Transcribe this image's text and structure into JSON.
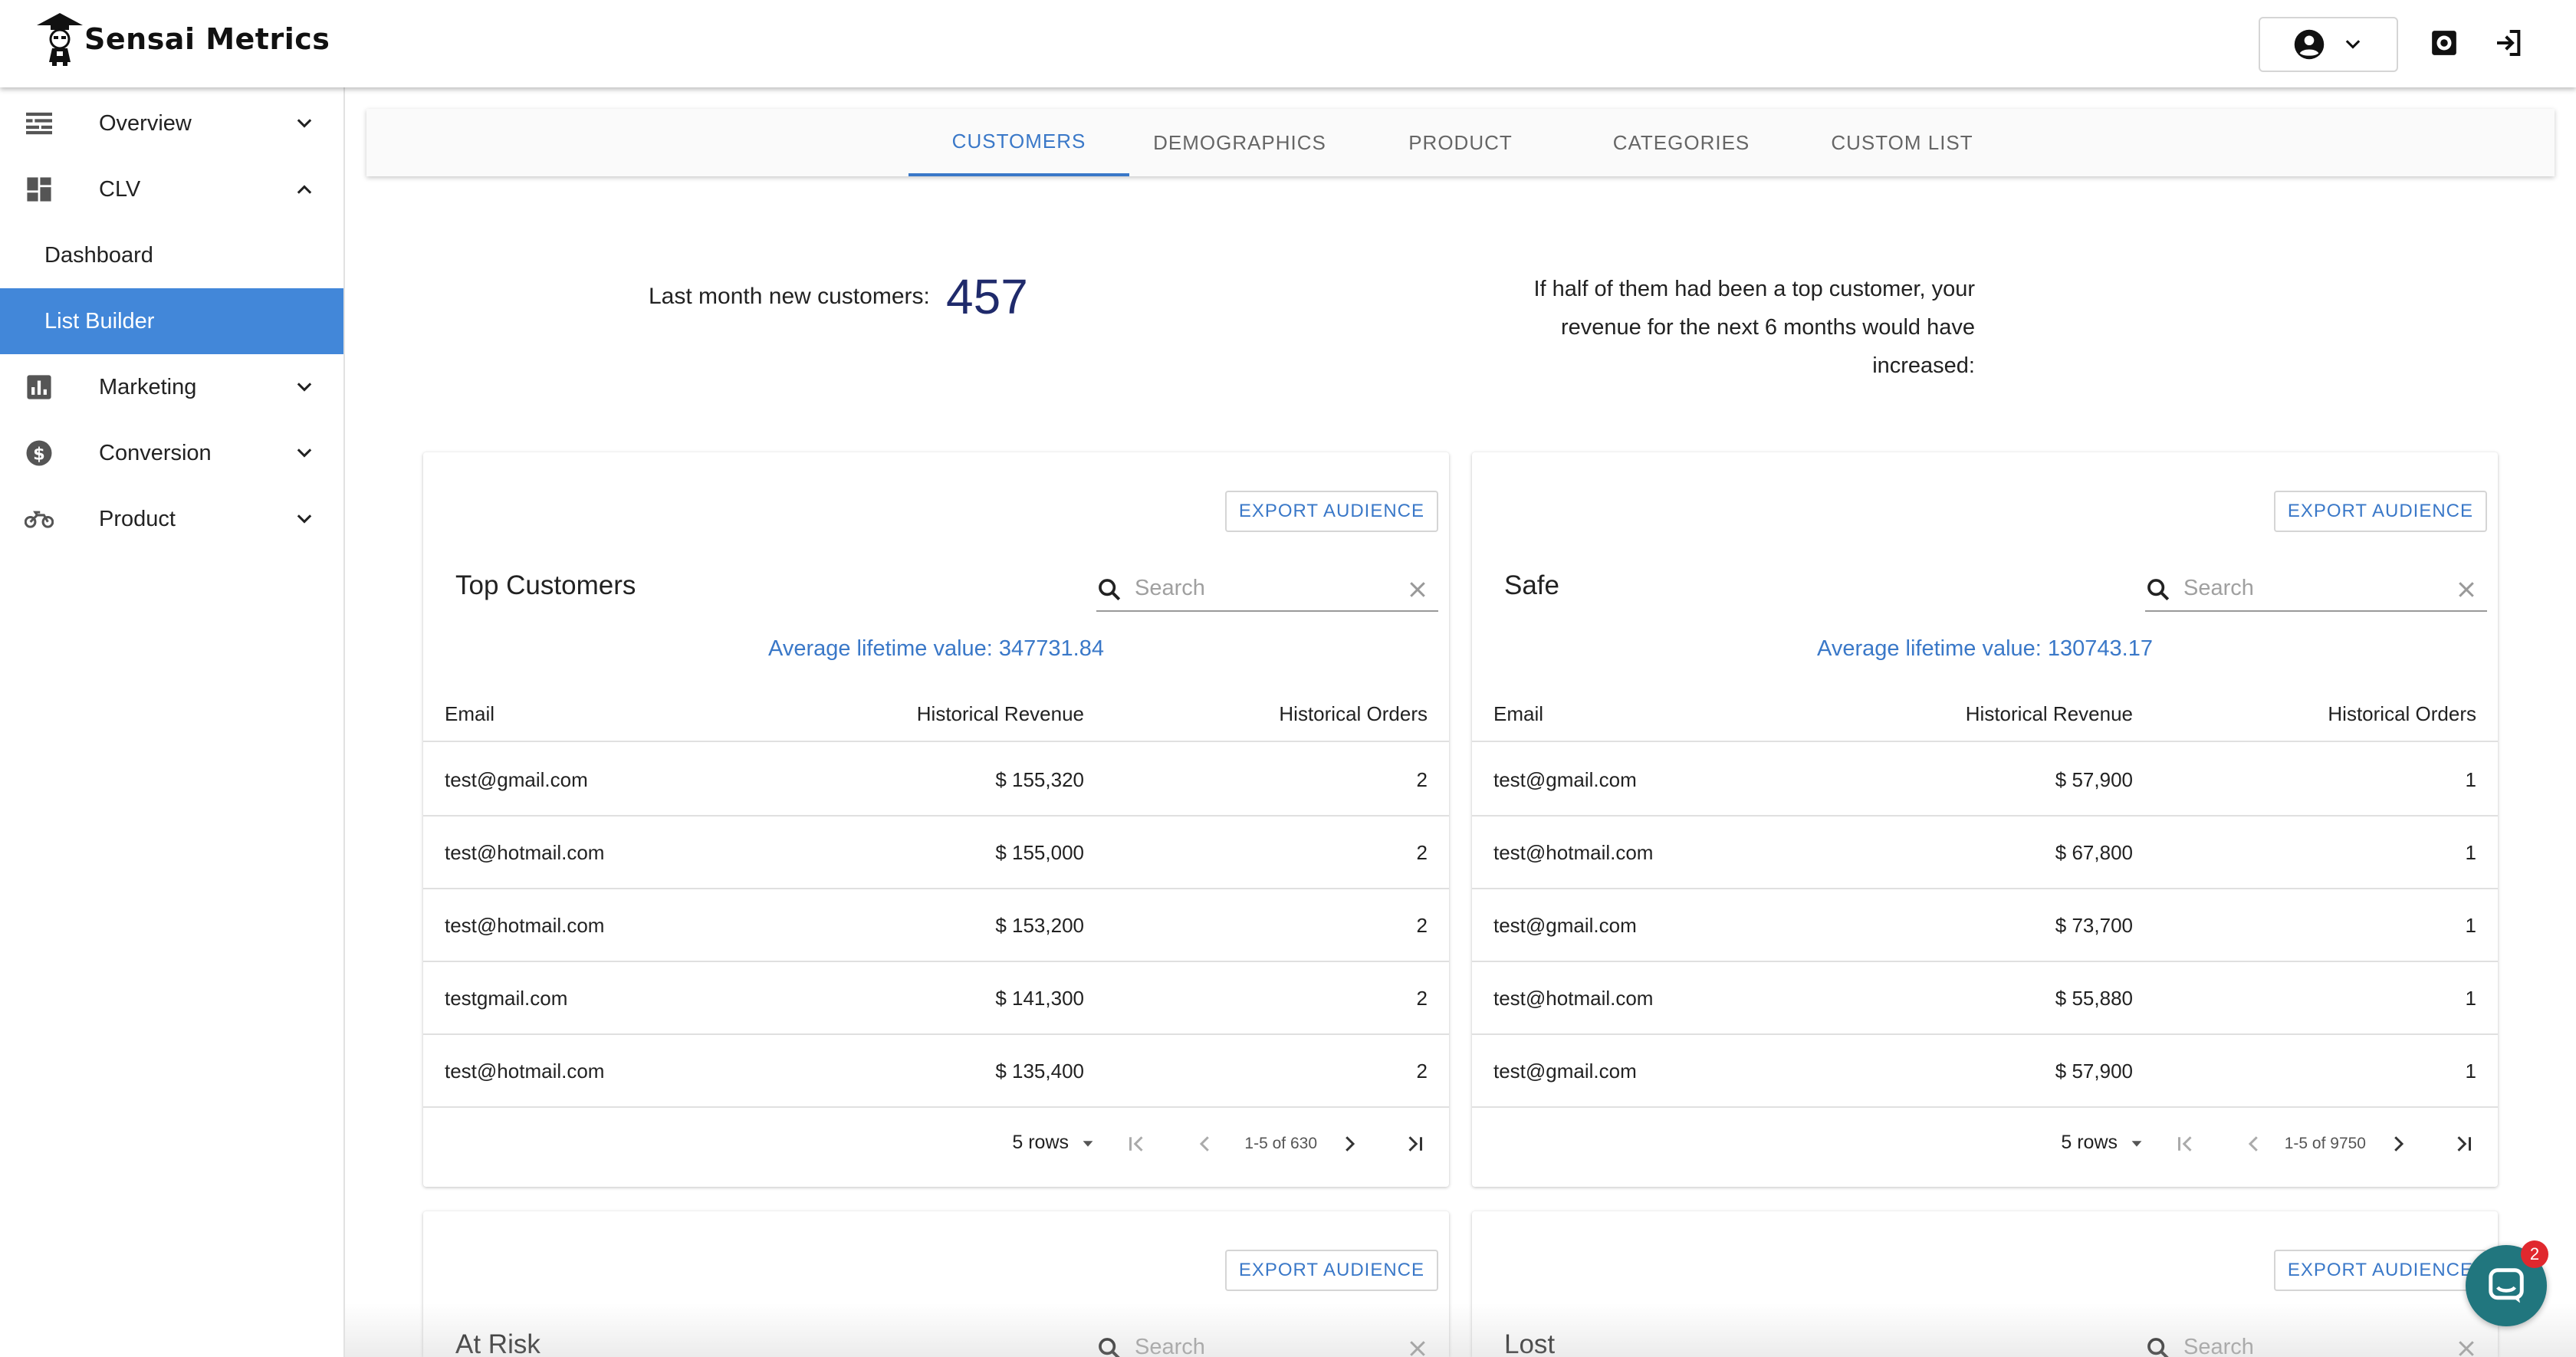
{
  "app": {
    "name": "Sensai Metrics"
  },
  "header": {
    "user_icon": "account-circle-icon",
    "settings_icon": "settings-icon",
    "logout_icon": "logout-icon"
  },
  "sidebar": {
    "items": [
      {
        "label": "Overview",
        "icon": "overview-icon",
        "expanded": false
      },
      {
        "label": "CLV",
        "icon": "dashboard-icon",
        "expanded": true,
        "children": [
          {
            "label": "Dashboard",
            "active": false
          },
          {
            "label": "List Builder",
            "active": true
          }
        ]
      },
      {
        "label": "Marketing",
        "icon": "bar-chart-icon",
        "expanded": false
      },
      {
        "label": "Conversion",
        "icon": "dollar-icon",
        "expanded": false
      },
      {
        "label": "Product",
        "icon": "motorbike-icon",
        "expanded": false
      }
    ]
  },
  "tabs": [
    {
      "label": "CUSTOMERS",
      "active": true
    },
    {
      "label": "DEMOGRAPHICS",
      "active": false
    },
    {
      "label": "PRODUCT",
      "active": false
    },
    {
      "label": "CATEGORIES",
      "active": false
    },
    {
      "label": "CUSTOM LIST",
      "active": false
    }
  ],
  "summary": {
    "label": "Last month new customers:",
    "value": "457",
    "note": "If half of them had been a top customer, your revenue for the next 6 months would have increased:"
  },
  "columns": {
    "email": "Email",
    "revenue": "Historical Revenue",
    "orders": "Historical Orders"
  },
  "export_label": "EXPORT AUDIENCE",
  "search_placeholder": "Search",
  "cards": [
    {
      "title": "Top Customers",
      "avg": "Average lifetime value: 347731.84",
      "rows": [
        {
          "email": "test@gmail.com",
          "revenue": "$ 155,320",
          "orders": "2"
        },
        {
          "email": "test@hotmail.com",
          "revenue": "$ 155,000",
          "orders": "2"
        },
        {
          "email": "test@hotmail.com",
          "revenue": "$ 153,200",
          "orders": "2"
        },
        {
          "email": "testgmail.com",
          "revenue": "$ 141,300",
          "orders": "2"
        },
        {
          "email": "test@hotmail.com",
          "revenue": "$ 135,400",
          "orders": "2"
        }
      ],
      "rows_per_page": "5 rows",
      "range": "1-5 of 630"
    },
    {
      "title": "Safe",
      "avg": "Average lifetime value: 130743.17",
      "rows": [
        {
          "email": "test@gmail.com",
          "revenue": "$ 57,900",
          "orders": "1"
        },
        {
          "email": "test@hotmail.com",
          "revenue": "$ 67,800",
          "orders": "1"
        },
        {
          "email": "test@gmail.com",
          "revenue": "$ 73,700",
          "orders": "1"
        },
        {
          "email": "test@hotmail.com",
          "revenue": "$ 55,880",
          "orders": "1"
        },
        {
          "email": "test@gmail.com",
          "revenue": "$ 57,900",
          "orders": "1"
        }
      ],
      "rows_per_page": "5 rows",
      "range": "1-5 of 9750"
    },
    {
      "title": "At Risk"
    },
    {
      "title": "Lost"
    }
  ],
  "chat": {
    "badge": "2",
    "icon": "chat-icon"
  },
  "colors": {
    "accent": "#3a78c8",
    "active_nav": "#4287d9",
    "value": "#1f2a6b",
    "chat": "#21767e",
    "badge": "#e0282e"
  }
}
